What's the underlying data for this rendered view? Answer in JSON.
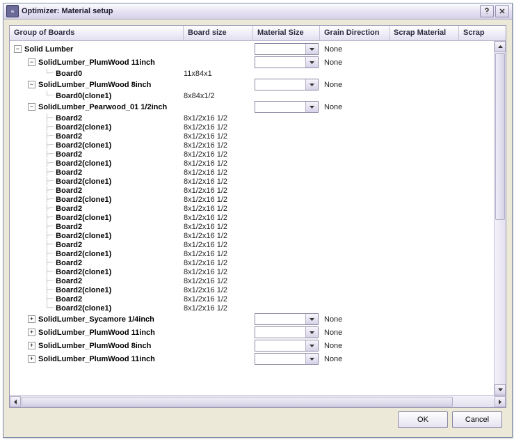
{
  "window": {
    "title": "Optimizer: Material setup"
  },
  "columns": {
    "c0": "Group of Boards",
    "c1": "Board size",
    "c2": "Material Size",
    "c3": "Grain Direction",
    "c4": "Scrap Material",
    "c5": "Scrap"
  },
  "tree": {
    "root": {
      "label": "Solid Lumber",
      "grain": "None"
    },
    "grp1": {
      "label": "SolidLumber_PlumWood 11inch",
      "grain": "None",
      "leaf": {
        "label": "Board0",
        "size": "11x84x1"
      }
    },
    "grp2": {
      "label": "SolidLumber_PlumWood 8inch",
      "grain": "None",
      "leaf": {
        "label": "Board0(clone1)",
        "size": "8x84x1/2"
      }
    },
    "grp3": {
      "label": "SolidLumber_Pearwood_01 1/2inch",
      "grain": "None",
      "leaves": [
        {
          "label": "Board2",
          "size": "8x1/2x16 1/2"
        },
        {
          "label": "Board2(clone1)",
          "size": "8x1/2x16 1/2"
        },
        {
          "label": "Board2",
          "size": "8x1/2x16 1/2"
        },
        {
          "label": "Board2(clone1)",
          "size": "8x1/2x16 1/2"
        },
        {
          "label": "Board2",
          "size": "8x1/2x16 1/2"
        },
        {
          "label": "Board2(clone1)",
          "size": "8x1/2x16 1/2"
        },
        {
          "label": "Board2",
          "size": "8x1/2x16 1/2"
        },
        {
          "label": "Board2(clone1)",
          "size": "8x1/2x16 1/2"
        },
        {
          "label": "Board2",
          "size": "8x1/2x16 1/2"
        },
        {
          "label": "Board2(clone1)",
          "size": "8x1/2x16 1/2"
        },
        {
          "label": "Board2",
          "size": "8x1/2x16 1/2"
        },
        {
          "label": "Board2(clone1)",
          "size": "8x1/2x16 1/2"
        },
        {
          "label": "Board2",
          "size": "8x1/2x16 1/2"
        },
        {
          "label": "Board2(clone1)",
          "size": "8x1/2x16 1/2"
        },
        {
          "label": "Board2",
          "size": "8x1/2x16 1/2"
        },
        {
          "label": "Board2(clone1)",
          "size": "8x1/2x16 1/2"
        },
        {
          "label": "Board2",
          "size": "8x1/2x16 1/2"
        },
        {
          "label": "Board2(clone1)",
          "size": "8x1/2x16 1/2"
        },
        {
          "label": "Board2",
          "size": "8x1/2x16 1/2"
        },
        {
          "label": "Board2(clone1)",
          "size": "8x1/2x16 1/2"
        },
        {
          "label": "Board2",
          "size": "8x1/2x16 1/2"
        },
        {
          "label": "Board2(clone1)",
          "size": "8x1/2x16 1/2"
        }
      ]
    },
    "grp4": {
      "label": "SolidLumber_Sycamore 1/4inch",
      "grain": "None"
    },
    "grp5": {
      "label": "SolidLumber_PlumWood 11inch",
      "grain": "None"
    },
    "grp6": {
      "label": "SolidLumber_PlumWood 8inch",
      "grain": "None"
    },
    "grp7": {
      "label": "SolidLumber_PlumWood 11inch",
      "grain": "None"
    }
  },
  "buttons": {
    "ok": "OK",
    "cancel": "Cancel"
  }
}
